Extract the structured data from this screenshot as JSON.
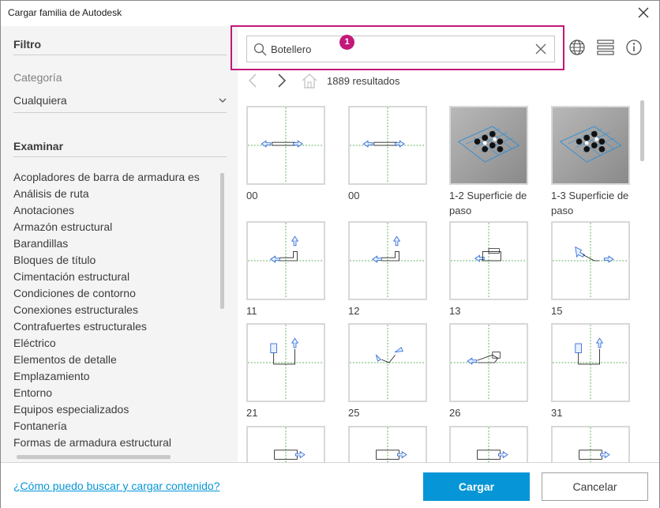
{
  "window": {
    "title": "Cargar familia de Autodesk"
  },
  "filter": {
    "heading": "Filtro",
    "category_label": "Categoría",
    "category_value": "Cualquiera"
  },
  "browse": {
    "heading": "Examinar",
    "items": [
      "Acopladores de barra de armadura es",
      "Análisis de ruta",
      "Anotaciones",
      "Armazón estructural",
      "Barandillas",
      "Bloques de título",
      "Cimentación estructural",
      "Condiciones de contorno",
      "Conexiones estructurales",
      "Contrafuertes estructurales",
      "Eléctrico",
      "Elementos de detalle",
      "Emplazamiento",
      "Entorno",
      "Equipos especializados",
      "Fontanería",
      "Formas de armadura estructural"
    ]
  },
  "search": {
    "value": "Botellero",
    "badge": "1"
  },
  "results": {
    "count_text": "1889 resultados"
  },
  "grid": {
    "items": [
      {
        "label": "00",
        "kind": "arrow-h"
      },
      {
        "label": "00",
        "kind": "arrow-h"
      },
      {
        "label": "1-2 Superficie de paso",
        "kind": "iso"
      },
      {
        "label": "1-3 Superficie de paso",
        "kind": "iso"
      },
      {
        "label": "11",
        "kind": "fitting"
      },
      {
        "label": "12",
        "kind": "fitting"
      },
      {
        "label": "13",
        "kind": "fitting2"
      },
      {
        "label": "15",
        "kind": "fitting3"
      },
      {
        "label": "21",
        "kind": "fitting4"
      },
      {
        "label": "25",
        "kind": "fitting5"
      },
      {
        "label": "26",
        "kind": "fitting6"
      },
      {
        "label": "31",
        "kind": "fitting4"
      },
      {
        "label": "",
        "kind": "partial"
      },
      {
        "label": "",
        "kind": "partial"
      },
      {
        "label": "",
        "kind": "partial"
      },
      {
        "label": "",
        "kind": "partial"
      }
    ]
  },
  "footer": {
    "help_link": "¿Cómo puedo buscar y cargar contenido?",
    "load_button": "Cargar",
    "cancel_button": "Cancelar"
  },
  "colors": {
    "accent": "#0696d7",
    "highlight": "#c2187a"
  }
}
